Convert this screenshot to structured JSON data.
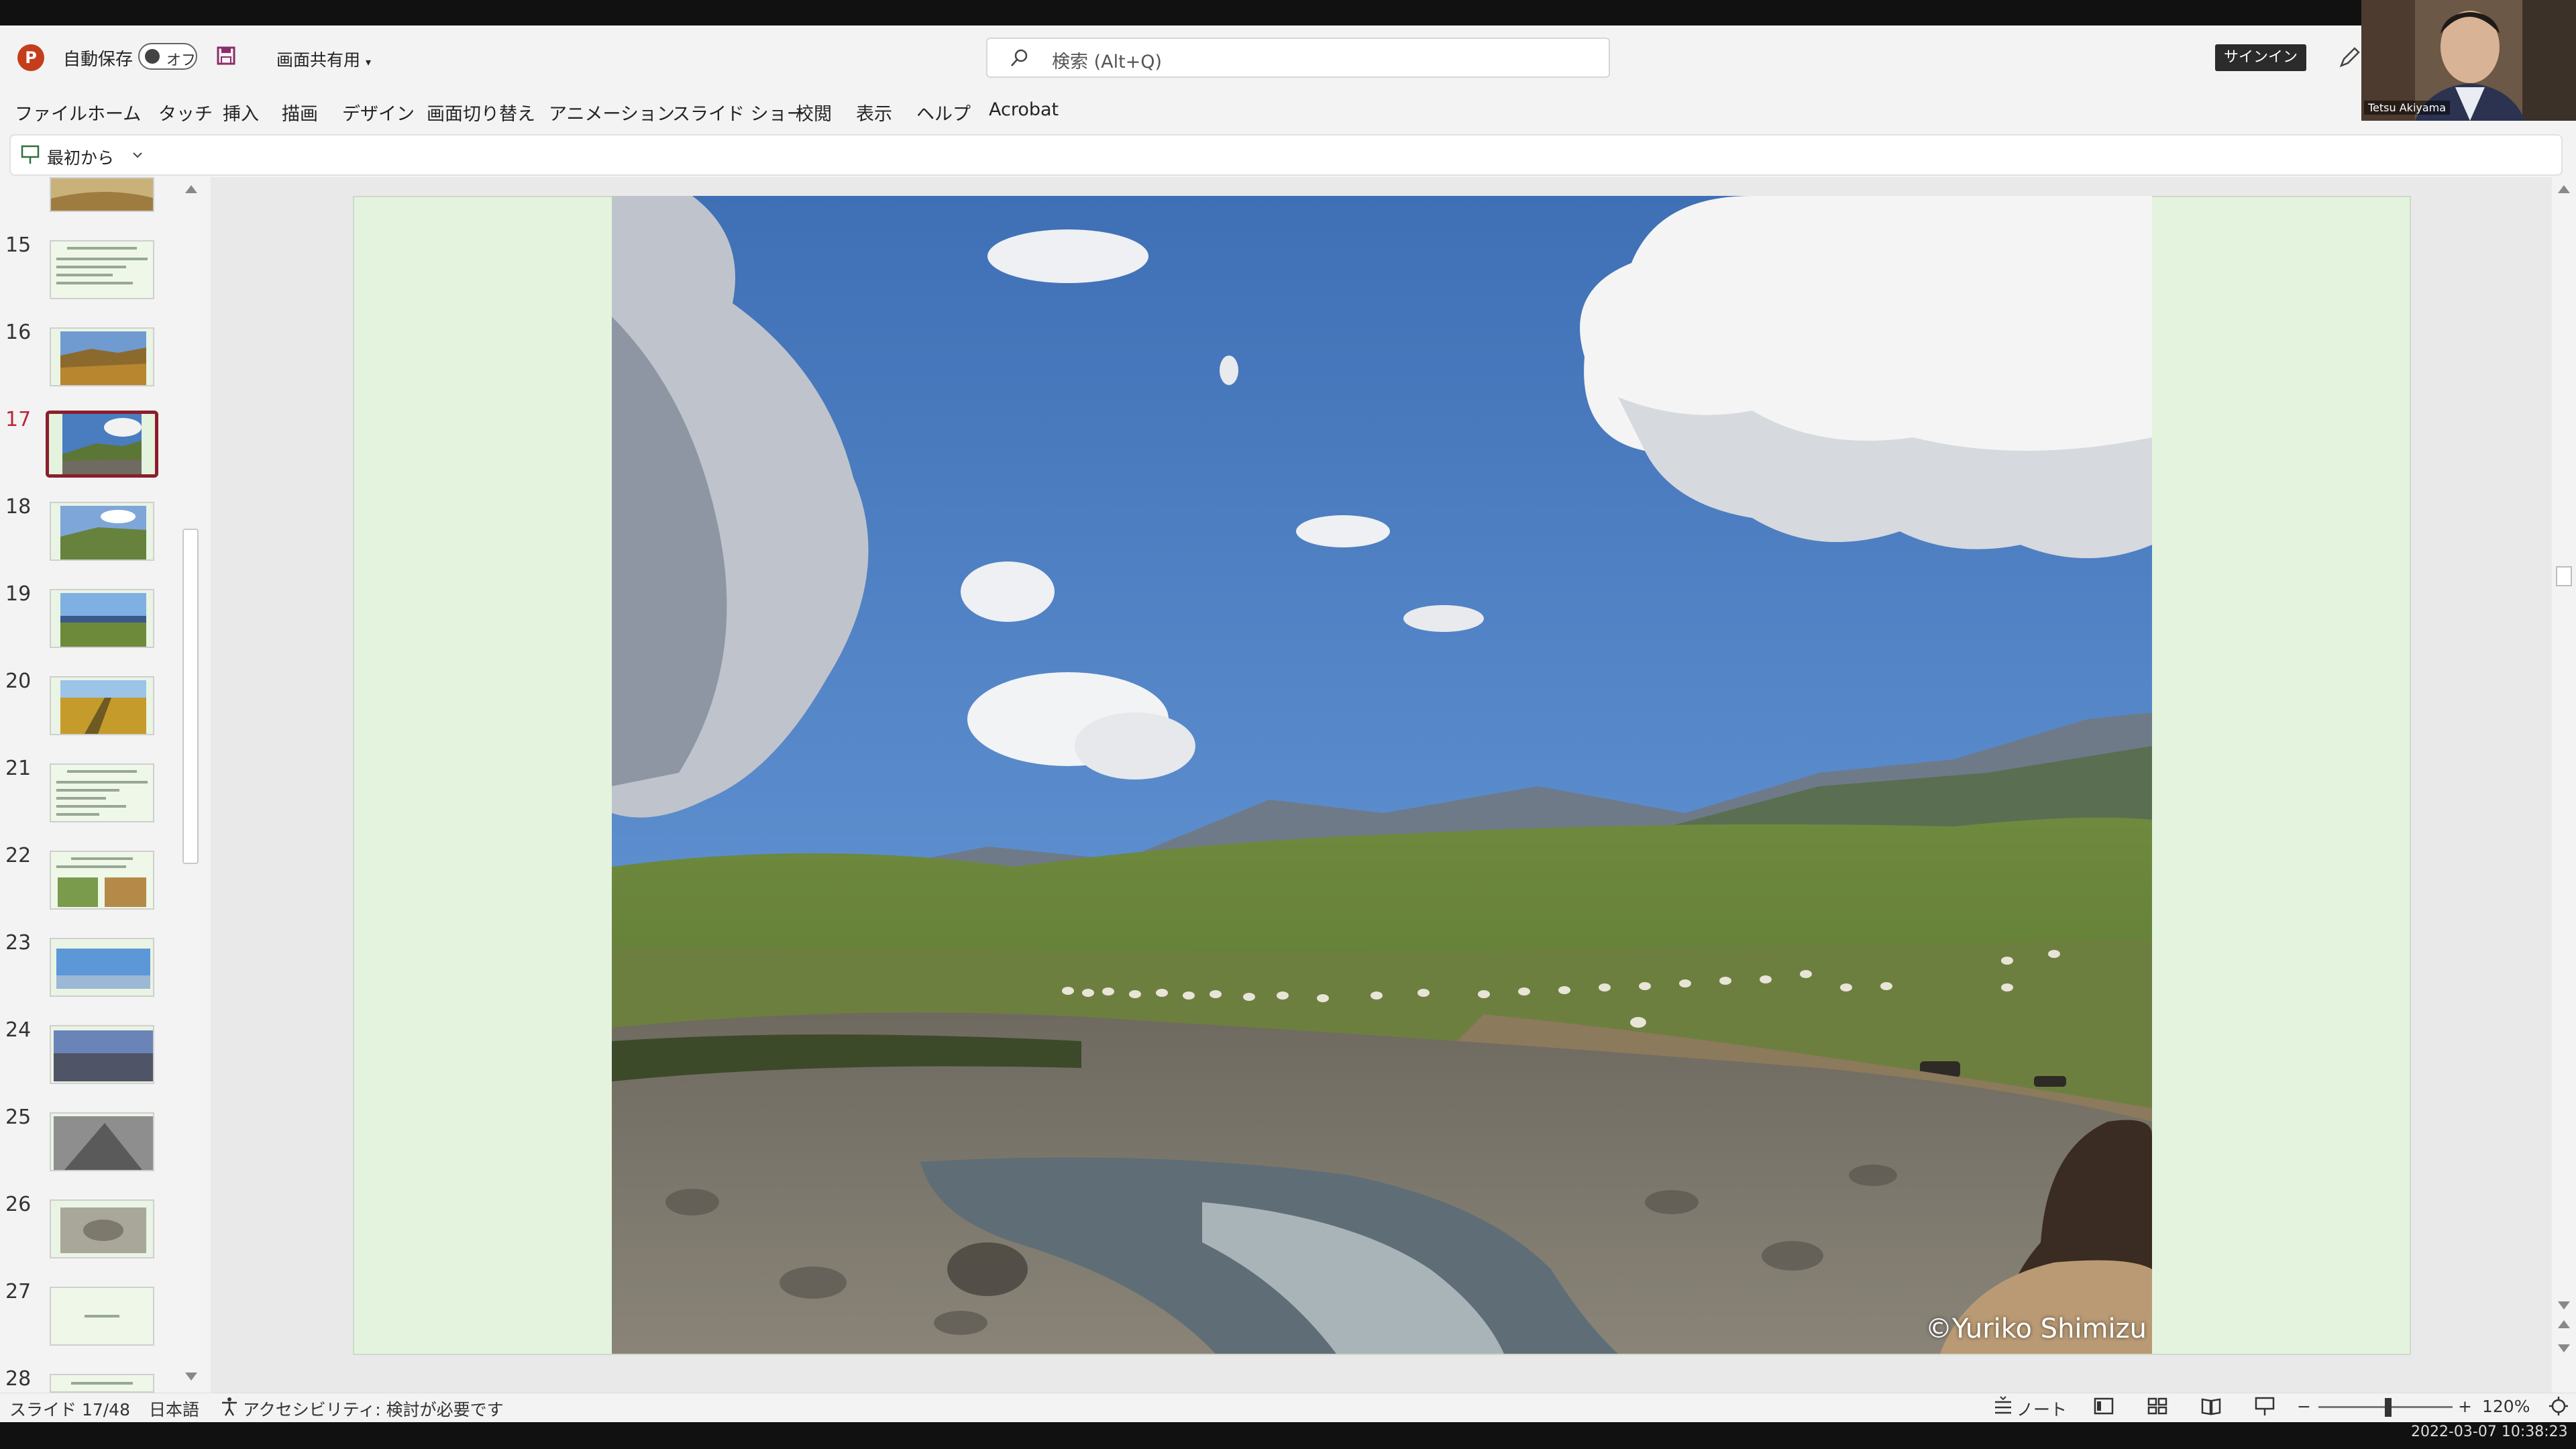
{
  "titlebar": {
    "autosave_label": "自動保存",
    "autosave_state": "オフ",
    "share_label": "画面共有用",
    "search_placeholder": "検索 (Alt+Q)",
    "signin_label": "サインイン"
  },
  "menu": {
    "items": [
      "ファイル",
      "ホーム",
      "タッチ",
      "挿入",
      "描画",
      "デザイン",
      "画面切り替え",
      "アニメーション",
      "スライド ショー",
      "校閲",
      "表示",
      "ヘルプ",
      "Acrobat"
    ]
  },
  "toolbar": {
    "start_label": "最初から"
  },
  "thumbnails": {
    "numbers": [
      "15",
      "16",
      "17",
      "18",
      "19",
      "20",
      "21",
      "22",
      "23",
      "24",
      "25",
      "26",
      "27",
      "28"
    ],
    "active": "17"
  },
  "slide": {
    "credit": "©Yuriko Shimizu"
  },
  "status": {
    "slide_counter": "スライド 17/48",
    "language": "日本語",
    "accessibility": "アクセシビリティ: 検討が必要です",
    "notes_label": "ノート",
    "zoom_level": "120%",
    "zoom_value_fraction": 0.52,
    "timestamp": "2022-03-07 10:38:23"
  },
  "webcam": {
    "name": "Tetsu Akiyama"
  },
  "colors": {
    "accent": "#b9283b",
    "ppt_red": "#c43e1c",
    "slide_bg": "#e4f3de"
  }
}
